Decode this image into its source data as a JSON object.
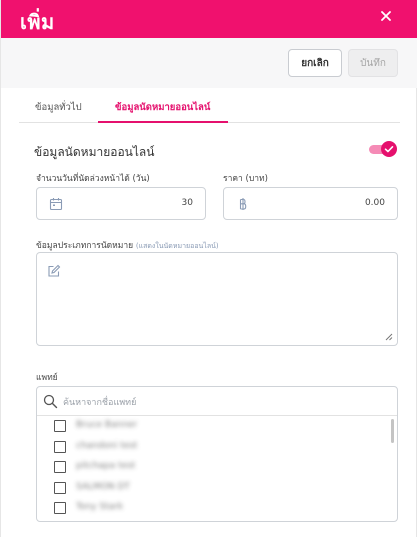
{
  "header": {
    "title": "เพิ่ม",
    "close_icon": "close-icon"
  },
  "toolbar": {
    "cancel_label": "ยกเลิก",
    "save_label": "บันทึก"
  },
  "tabs": [
    {
      "label": "ข้อมูลทั่วไป",
      "active": false
    },
    {
      "label": "ข้อมูลนัดหมายออนไลน์",
      "active": true
    }
  ],
  "section": {
    "title": "ข้อมูลนัดหมายออนไลน์",
    "toggle_on": true
  },
  "fields": {
    "days_label": "จำนวนวันที่นัดล่วงหน้าได้ (วัน)",
    "days_value": "30",
    "price_label": "ราคา (บาท)",
    "price_value": "0.00",
    "type_label": "ข้อมูลประเภทการนัดหมาย",
    "type_hint": "(แสดงในนัดหมายออนไลน์)"
  },
  "doctors": {
    "label": "แพทย์",
    "search_placeholder": "ค้นหาจากชื่อแพทย์",
    "items": [
      "Bruce Banner",
      "chandoni test",
      "pitchapa test",
      "SALMON DT",
      "Tony Stark"
    ]
  },
  "colors": {
    "accent": "#f0116e",
    "toolbar_bg": "#f7f7f8"
  }
}
